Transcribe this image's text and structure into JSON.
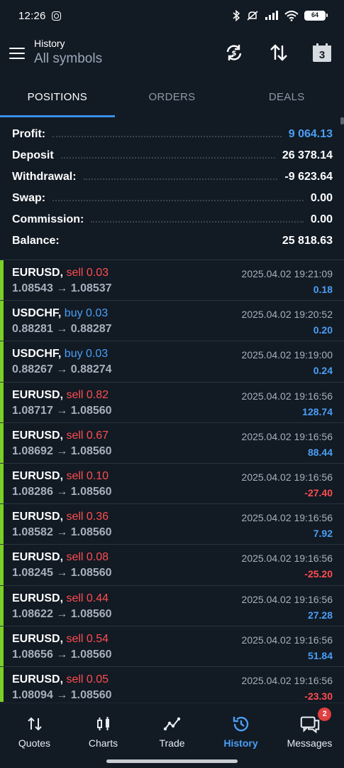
{
  "status": {
    "time": "12:26",
    "battery": "64"
  },
  "appbar": {
    "title": "History",
    "subtitle": "All symbols",
    "calendar_day": "3"
  },
  "tabs": [
    {
      "label": "POSITIONS",
      "active": true
    },
    {
      "label": "ORDERS",
      "active": false
    },
    {
      "label": "DEALS",
      "active": false
    }
  ],
  "summary": [
    {
      "label": "Profit:",
      "value": "9 064.13",
      "highlight": true
    },
    {
      "label": "Deposit",
      "value": "26 378.14"
    },
    {
      "label": "Withdrawal:",
      "value": "-9 623.64"
    },
    {
      "label": "Swap:",
      "value": "0.00"
    },
    {
      "label": "Commission:",
      "value": "0.00"
    },
    {
      "label": "Balance:",
      "value": "25 818.63"
    }
  ],
  "positions": [
    {
      "symbol": "EURUSD,",
      "side": "sell 0.03",
      "type": "sell",
      "prices": "1.08543 → 1.08537",
      "datetime": "2025.04.02 19:21:09",
      "profit": "0.18",
      "sign": "pos"
    },
    {
      "symbol": "USDCHF,",
      "side": "buy 0.03",
      "type": "buy",
      "prices": "0.88281 → 0.88287",
      "datetime": "2025.04.02 19:20:52",
      "profit": "0.20",
      "sign": "pos"
    },
    {
      "symbol": "USDCHF,",
      "side": "buy 0.03",
      "type": "buy",
      "prices": "0.88267 → 0.88274",
      "datetime": "2025.04.02 19:19:00",
      "profit": "0.24",
      "sign": "pos"
    },
    {
      "symbol": "EURUSD,",
      "side": "sell 0.82",
      "type": "sell",
      "prices": "1.08717 → 1.08560",
      "datetime": "2025.04.02 19:16:56",
      "profit": "128.74",
      "sign": "pos"
    },
    {
      "symbol": "EURUSD,",
      "side": "sell 0.67",
      "type": "sell",
      "prices": "1.08692 → 1.08560",
      "datetime": "2025.04.02 19:16:56",
      "profit": "88.44",
      "sign": "pos"
    },
    {
      "symbol": "EURUSD,",
      "side": "sell 0.10",
      "type": "sell",
      "prices": "1.08286 → 1.08560",
      "datetime": "2025.04.02 19:16:56",
      "profit": "-27.40",
      "sign": "neg"
    },
    {
      "symbol": "EURUSD,",
      "side": "sell 0.36",
      "type": "sell",
      "prices": "1.08582 → 1.08560",
      "datetime": "2025.04.02 19:16:56",
      "profit": "7.92",
      "sign": "pos"
    },
    {
      "symbol": "EURUSD,",
      "side": "sell 0.08",
      "type": "sell",
      "prices": "1.08245 → 1.08560",
      "datetime": "2025.04.02 19:16:56",
      "profit": "-25.20",
      "sign": "neg"
    },
    {
      "symbol": "EURUSD,",
      "side": "sell 0.44",
      "type": "sell",
      "prices": "1.08622 → 1.08560",
      "datetime": "2025.04.02 19:16:56",
      "profit": "27.28",
      "sign": "pos"
    },
    {
      "symbol": "EURUSD,",
      "side": "sell 0.54",
      "type": "sell",
      "prices": "1.08656 → 1.08560",
      "datetime": "2025.04.02 19:16:56",
      "profit": "51.84",
      "sign": "pos"
    },
    {
      "symbol": "EURUSD,",
      "side": "sell 0.05",
      "type": "sell",
      "prices": "1.08094 → 1.08560",
      "datetime": "2025.04.02 19:16:56",
      "profit": "-23.30",
      "sign": "neg"
    }
  ],
  "bottomnav": [
    {
      "label": "Quotes",
      "icon": "quotes-icon",
      "active": false
    },
    {
      "label": "Charts",
      "icon": "charts-icon",
      "active": false
    },
    {
      "label": "Trade",
      "icon": "trade-icon",
      "active": false
    },
    {
      "label": "History",
      "icon": "history-icon",
      "active": true
    },
    {
      "label": "Messages",
      "icon": "messages-icon",
      "active": false,
      "badge": "2"
    }
  ],
  "colors": {
    "background": "#121a24",
    "accent": "#4a9ff5",
    "sell": "#ff4d4f",
    "position_bar": "#7ad125"
  }
}
